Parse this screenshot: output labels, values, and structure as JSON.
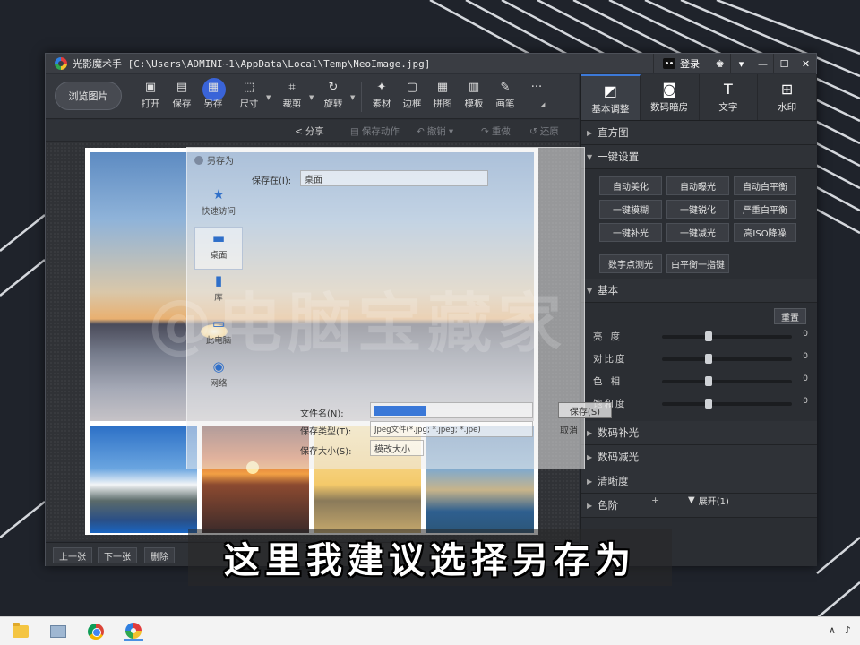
{
  "window": {
    "title": "光影魔术手  [C:\\Users\\ADMINI~1\\AppData\\Local\\Temp\\NeoImage.jpg]",
    "login_label": "登录",
    "controls": [
      "▾",
      "—",
      "☐",
      "✕"
    ]
  },
  "toolbar": {
    "browse_label": "浏览图片",
    "tools": [
      {
        "label": "打开",
        "icon": "open-icon"
      },
      {
        "label": "保存",
        "icon": "save-icon"
      },
      {
        "label": "另存",
        "icon": "save-as-icon"
      },
      {
        "label": "尺寸",
        "icon": "resize-icon"
      },
      {
        "label": "裁剪",
        "icon": "crop-icon"
      },
      {
        "label": "旋转",
        "icon": "rotate-icon"
      },
      {
        "label": "素材",
        "icon": "material-icon"
      },
      {
        "label": "边框",
        "icon": "border-icon"
      },
      {
        "label": "拼图",
        "icon": "collage-icon"
      },
      {
        "label": "模板",
        "icon": "template-icon"
      },
      {
        "label": "画笔",
        "icon": "brush-icon"
      },
      {
        "label": "···",
        "icon": "more-icon"
      }
    ]
  },
  "subbar": {
    "share": "分享",
    "save_action": "保存动作",
    "undo": "撤销",
    "redo": "重做",
    "restore": "还原"
  },
  "right_panel": {
    "tabs": [
      {
        "label": "基本调整",
        "icon": "adjust-icon"
      },
      {
        "label": "数码暗房",
        "icon": "camera-icon"
      },
      {
        "label": "文字",
        "icon": "text-icon"
      },
      {
        "label": "水印",
        "icon": "watermark-icon"
      }
    ],
    "histogram": "直方图",
    "one_click": "一键设置",
    "one_click_buttons": [
      "自动美化",
      "自动曝光",
      "自动白平衡",
      "一键模糊",
      "一键锐化",
      "严重白平衡",
      "一键补光",
      "一键减光",
      "高ISO降噪"
    ],
    "extra_buttons": [
      "数字点测光",
      "白平衡一指键"
    ],
    "basic": "基本",
    "reset": "重置",
    "sliders": [
      {
        "name": "亮度",
        "value": "0"
      },
      {
        "name": "对比度",
        "value": "0"
      },
      {
        "name": "色相",
        "value": "0"
      },
      {
        "name": "饱和度",
        "value": "0"
      }
    ],
    "sections": [
      "数码补光",
      "数码减光",
      "清晰度",
      "色阶"
    ],
    "expand": "展开(1)"
  },
  "dialog": {
    "title": "另存为",
    "save_in_label": "保存在(I):",
    "save_in_value": "桌面",
    "side_items": [
      {
        "label": "快速访问",
        "icon": "star-icon"
      },
      {
        "label": "桌面",
        "icon": "desktop-icon"
      },
      {
        "label": "库",
        "icon": "library-icon"
      },
      {
        "label": "此电脑",
        "icon": "computer-icon"
      },
      {
        "label": "网络",
        "icon": "network-icon"
      }
    ],
    "filename_label": "文件名(N):",
    "type_label": "保存类型(T):",
    "type_value": "Jpeg文件(*.jpg; *.jpeg; *.jpe)",
    "size_label": "保存大小(S):",
    "size_value": "模改大小",
    "save_btn": "保存(S)",
    "cancel_btn": "取消"
  },
  "watermark_text": "@电脑宝藏家",
  "statusbar": {
    "prev": "上一张",
    "next": "下一张",
    "delete": "删除"
  },
  "subtitle": "这里我建议选择另存为"
}
